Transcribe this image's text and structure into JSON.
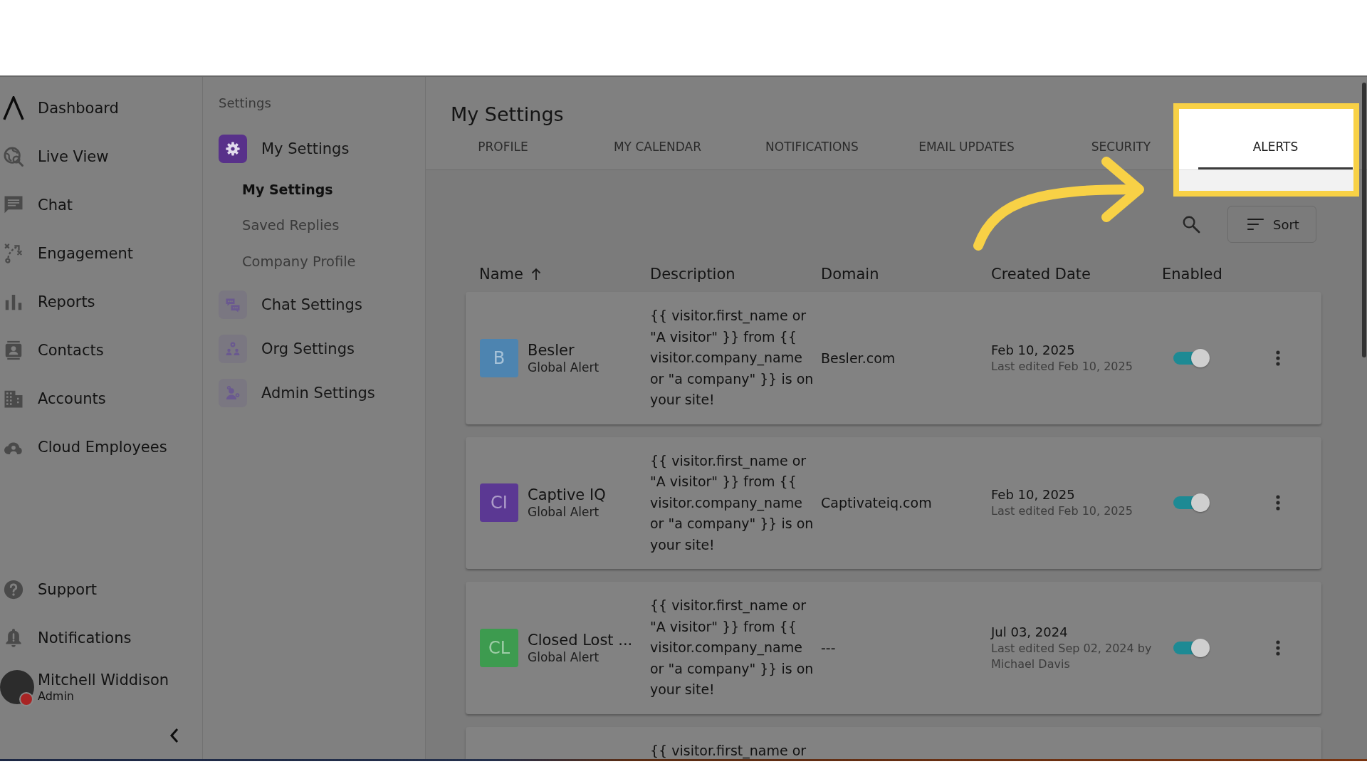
{
  "sidebar": {
    "items": [
      {
        "label": "Dashboard",
        "selected": false
      },
      {
        "label": "Live View",
        "selected": false
      },
      {
        "label": "Chat",
        "selected": false
      },
      {
        "label": "Engagement",
        "selected": false
      },
      {
        "label": "Reports",
        "selected": false
      },
      {
        "label": "Contacts",
        "selected": false
      },
      {
        "label": "Accounts",
        "selected": false
      },
      {
        "label": "Cloud Employees",
        "selected": false
      }
    ],
    "bottom_items": [
      {
        "label": "Support",
        "selected": false
      },
      {
        "label": "Notifications",
        "selected": false
      }
    ],
    "user": {
      "name": "Mitchell Widdison",
      "role": "Admin",
      "available": false
    }
  },
  "settings_nav": {
    "heading": "Settings",
    "groups": [
      {
        "label": "My Settings",
        "selected": true,
        "children": [
          {
            "label": "My Settings",
            "selected": true
          },
          {
            "label": "Saved Replies",
            "selected": false
          },
          {
            "label": "Company Profile",
            "selected": false
          }
        ]
      },
      {
        "label": "Chat Settings",
        "selected": false
      },
      {
        "label": "Org Settings",
        "selected": false
      },
      {
        "label": "Admin Settings",
        "selected": false
      }
    ]
  },
  "page": {
    "title": "My Settings",
    "tabs": [
      {
        "label": "PROFILE",
        "selected": false,
        "highlighted": false
      },
      {
        "label": "MY CALENDAR",
        "selected": false,
        "highlighted": false
      },
      {
        "label": "NOTIFICATIONS",
        "selected": false,
        "highlighted": false
      },
      {
        "label": "EMAIL UPDATES",
        "selected": false,
        "highlighted": false
      },
      {
        "label": "SECURITY",
        "selected": false,
        "highlighted": false
      },
      {
        "label": "ALERTS",
        "selected": true,
        "highlighted": true
      }
    ],
    "sort_button": "Sort"
  },
  "table": {
    "columns": [
      {
        "label": "Name",
        "sorted": true
      },
      {
        "label": "Description",
        "sorted": false
      },
      {
        "label": "Domain",
        "sorted": false
      },
      {
        "label": "Created Date",
        "sorted": false
      },
      {
        "label": "Enabled",
        "sorted": false
      }
    ],
    "rows": [
      {
        "initials": "B",
        "color": "#4d84b0",
        "name": "Besler",
        "type": "Global Alert",
        "description": "{{ visitor.first_name or \"A visitor\" }} from {{ visitor.company_name or \"a company\" }} is on your site!",
        "domain": "Besler.com",
        "created": "Feb 10, 2025",
        "edited": "Last edited Feb 10, 2025",
        "enabled": true
      },
      {
        "initials": "CI",
        "color": "#5b3893",
        "name": "Captive IQ",
        "type": "Global Alert",
        "description": "{{ visitor.first_name or \"A visitor\" }} from {{ visitor.company_name or \"a company\" }} is on your site!",
        "domain": "Captivateiq.com",
        "created": "Feb 10, 2025",
        "edited": "Last edited Feb 10, 2025",
        "enabled": true
      },
      {
        "initials": "CL",
        "color": "#3d9b4f",
        "name": "Closed Lost ...",
        "type": "Global Alert",
        "description": "{{ visitor.first_name or \"A visitor\" }} from {{ visitor.company_name or \"a company\" }} is on your site!",
        "domain": "---",
        "created": "Jul 03, 2024",
        "edited": "Last edited Sep 02, 2024 by Michael Davis",
        "enabled": true
      },
      {
        "description": "{{ visitor.first_name or"
      }
    ]
  }
}
